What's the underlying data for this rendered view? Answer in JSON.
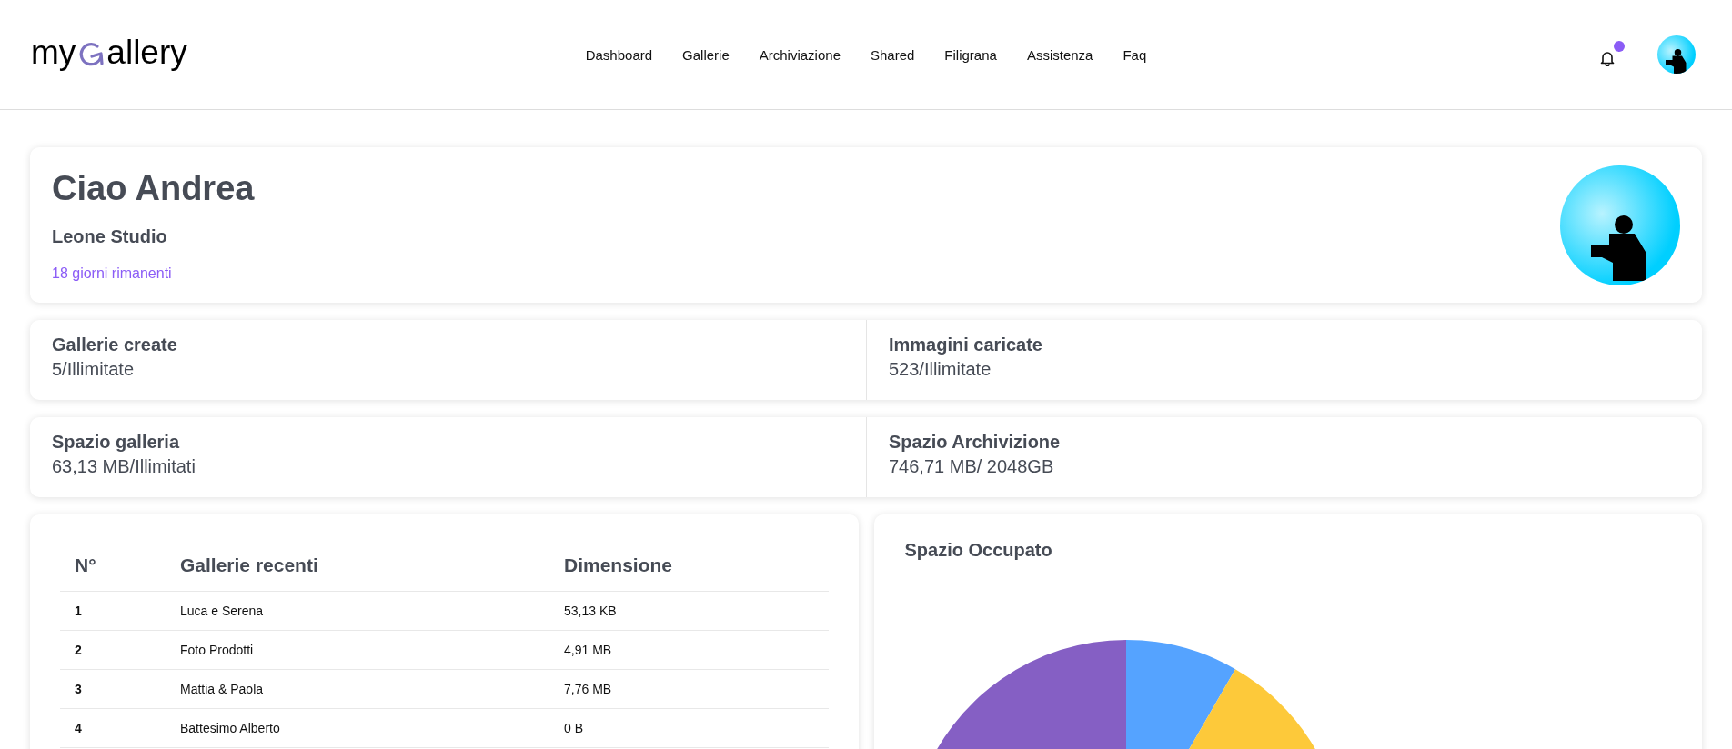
{
  "logo": {
    "prefix": "my",
    "suffix": "allery"
  },
  "nav": [
    {
      "label": "Dashboard"
    },
    {
      "label": "Gallerie"
    },
    {
      "label": "Archiviazione"
    },
    {
      "label": "Shared"
    },
    {
      "label": "Filigrana"
    },
    {
      "label": "Assistenza"
    },
    {
      "label": "Faq"
    }
  ],
  "notifications": {
    "unread": true
  },
  "welcome": {
    "greeting": "Ciao Andrea",
    "studio": "Leone Studio",
    "trial": "18 giorni rimanenti"
  },
  "stats": [
    [
      {
        "label": "Gallerie create",
        "value": "5/Illimitate"
      },
      {
        "label": "Immagini caricate",
        "value": "523/Illimitate"
      }
    ],
    [
      {
        "label": "Spazio galleria",
        "value": "63,13 MB/Illimitati"
      },
      {
        "label": "Spazio Archivizione",
        "value": "746,71 MB/ 2048GB"
      }
    ]
  ],
  "table": {
    "columns": [
      "N°",
      "Gallerie recenti",
      "Dimensione"
    ],
    "rows": [
      [
        "1",
        "Luca e Serena",
        "53,13 KB"
      ],
      [
        "2",
        "Foto Prodotti",
        "4,91 MB"
      ],
      [
        "3",
        "Mattia & Paola",
        "7,76 MB"
      ],
      [
        "4",
        "Battesimo Alberto",
        "0 B"
      ]
    ]
  },
  "storage_chart": {
    "title": "Spazio Occupato"
  }
}
